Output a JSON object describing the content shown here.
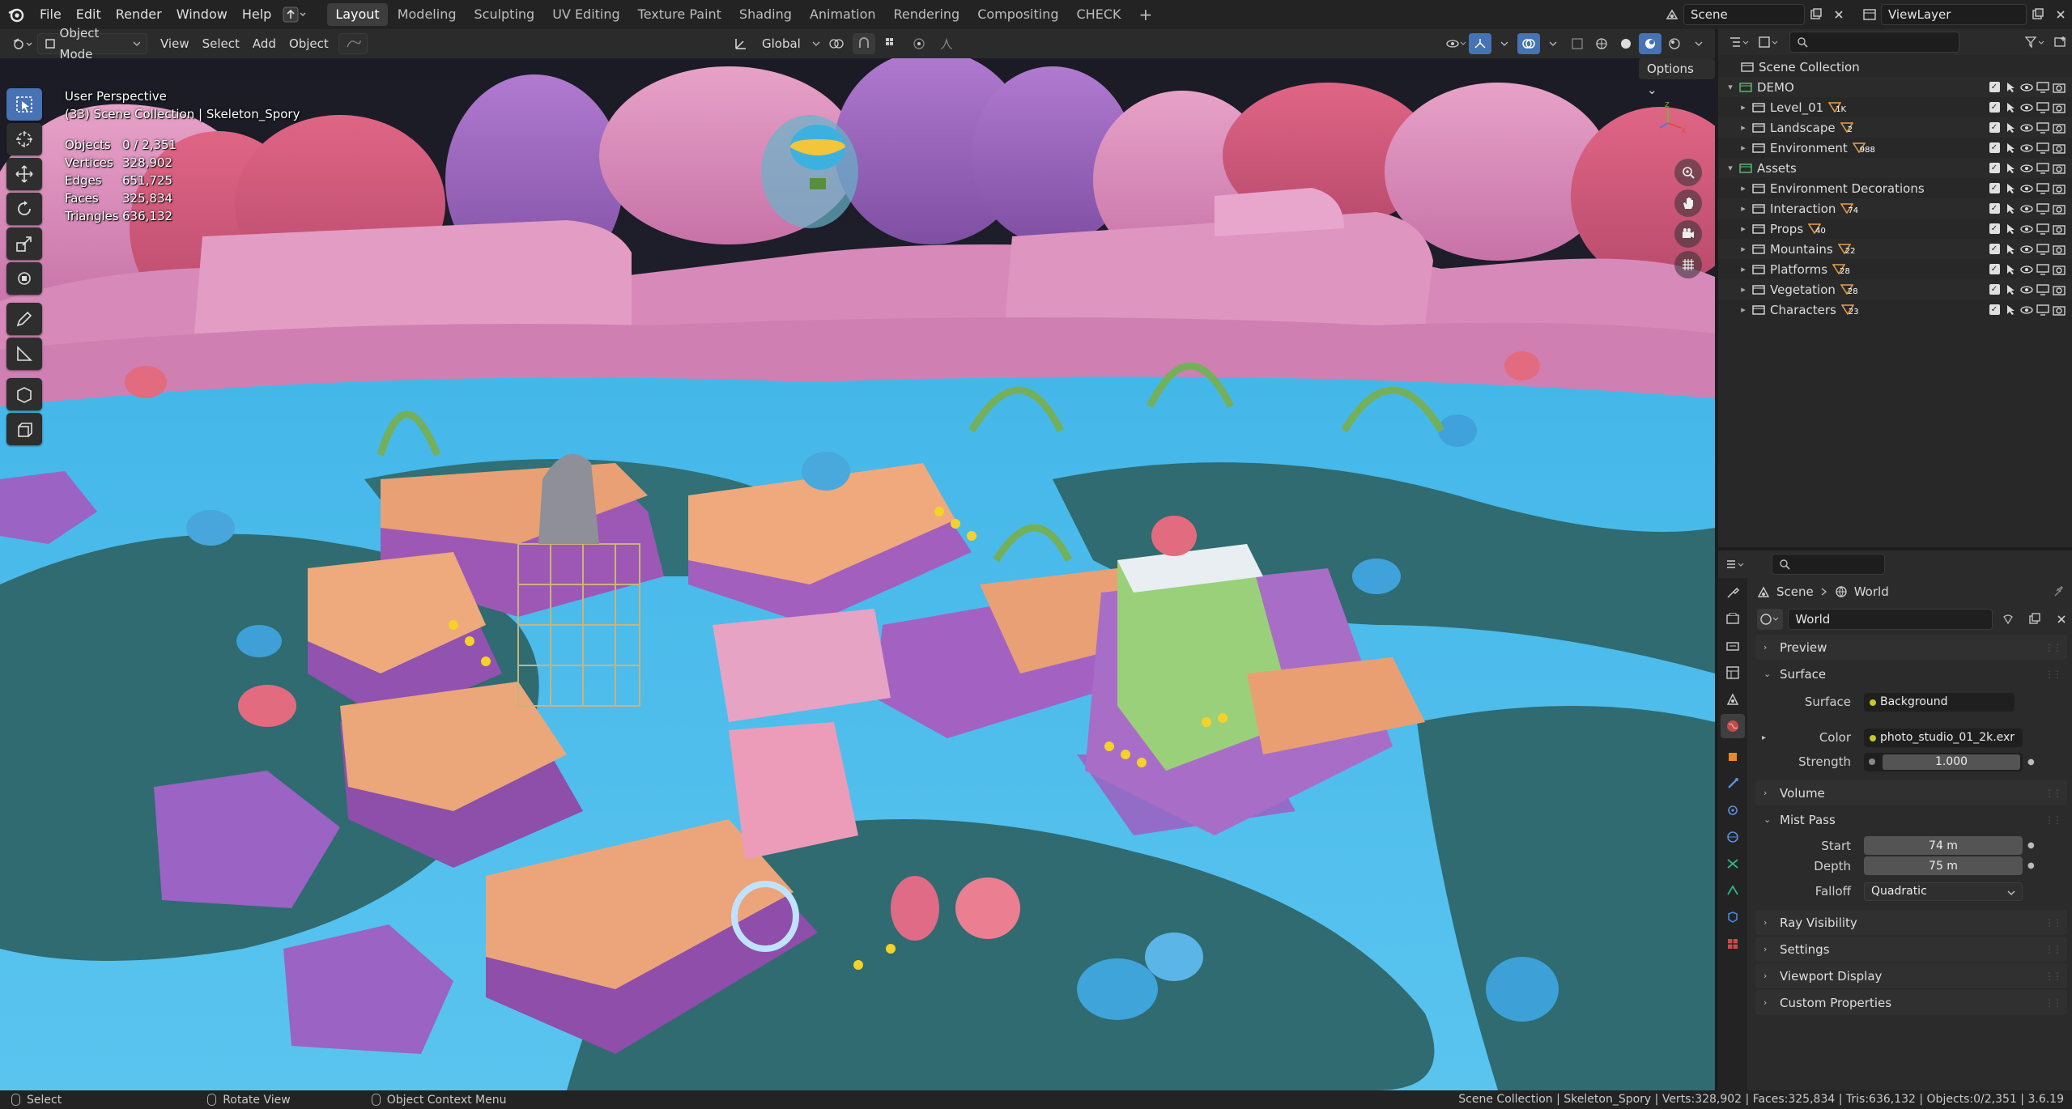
{
  "topbar": {
    "menus": [
      "File",
      "Edit",
      "Render",
      "Window",
      "Help"
    ],
    "workspaces": [
      "Layout",
      "Modeling",
      "Sculpting",
      "UV Editing",
      "Texture Paint",
      "Shading",
      "Animation",
      "Rendering",
      "Compositing",
      "CHECK"
    ],
    "active_workspace": "Layout",
    "scene_name": "Scene",
    "view_layer": "ViewLayer"
  },
  "viewport_header": {
    "mode": "Object Mode",
    "menus": [
      "View",
      "Select",
      "Add",
      "Object"
    ],
    "transform_orientation": "Global",
    "options_label": "Options"
  },
  "viewport": {
    "perspective_label": "User Perspective",
    "context_label": "(33) Scene Collection | Skeleton_Spory",
    "stats": [
      {
        "label": "Objects",
        "value": "0 / 2,351"
      },
      {
        "label": "Vertices",
        "value": "328,902"
      },
      {
        "label": "Edges",
        "value": "651,725"
      },
      {
        "label": "Faces",
        "value": "325,834"
      },
      {
        "label": "Triangles",
        "value": "636,132"
      }
    ],
    "tools": [
      "select-box-icon",
      "cursor-icon",
      "move-icon",
      "rotate-icon",
      "scale-icon",
      "transform-icon",
      "annotate-icon",
      "measure-icon",
      "add-cube-icon",
      "extrude-icon"
    ],
    "nav_buttons": [
      "zoom-icon",
      "hand-pan-icon",
      "camera-icon",
      "grid-ortho-icon"
    ]
  },
  "outliner": {
    "root": "Scene Collection",
    "rows": [
      {
        "label": "DEMO",
        "level": 1,
        "expanded": true,
        "count": ""
      },
      {
        "label": "Level_01",
        "level": 2,
        "expanded": false,
        "count": "1K"
      },
      {
        "label": "Landscape",
        "level": 2,
        "expanded": false,
        "count": "2"
      },
      {
        "label": "Environment",
        "level": 2,
        "expanded": false,
        "count": "988"
      },
      {
        "label": "Assets",
        "level": 1,
        "expanded": true,
        "count": ""
      },
      {
        "label": "Environment Decorations",
        "level": 2,
        "expanded": false,
        "count": ""
      },
      {
        "label": "Interaction",
        "level": 2,
        "expanded": false,
        "count": "74"
      },
      {
        "label": "Props",
        "level": 2,
        "expanded": false,
        "count": "40"
      },
      {
        "label": "Mountains",
        "level": 2,
        "expanded": false,
        "count": "22"
      },
      {
        "label": "Platforms",
        "level": 2,
        "expanded": false,
        "count": "28"
      },
      {
        "label": "Vegetation",
        "level": 2,
        "expanded": false,
        "count": "28"
      },
      {
        "label": "Characters",
        "level": 2,
        "expanded": false,
        "count": "23"
      }
    ]
  },
  "properties": {
    "breadcrumb": {
      "scene": "Scene",
      "world": "World"
    },
    "world_name": "World",
    "panels": {
      "preview": "Preview",
      "surface": "Surface",
      "volume": "Volume",
      "mist_pass": "Mist Pass",
      "ray_visibility": "Ray Visibility",
      "settings": "Settings",
      "viewport_display": "Viewport Display",
      "custom_properties": "Custom Properties"
    },
    "surface": {
      "surface_label": "Surface",
      "surface_value": "Background",
      "color_label": "Color",
      "color_value": "photo_studio_01_2k.exr",
      "strength_label": "Strength",
      "strength_value": "1.000"
    },
    "mist": {
      "start_label": "Start",
      "start_value": "74 m",
      "depth_label": "Depth",
      "depth_value": "75 m",
      "falloff_label": "Falloff",
      "falloff_value": "Quadratic"
    }
  },
  "statusbar": {
    "select": "Select",
    "rotate": "Rotate View",
    "context_menu": "Object Context Menu",
    "info": "Scene Collection | Skeleton_Spory | Verts:328,902 | Faces:325,834 | Tris:636,132 | Objects:0/2,351 | 3.6.19"
  },
  "colors": {
    "accent": "#4772b3",
    "water": "#4fb9e6",
    "pink_mountain": "#d988b4",
    "purple_mountain": "#9a63b8",
    "platform_orange": "#e9a074",
    "ground_teal": "#2f6b70"
  }
}
